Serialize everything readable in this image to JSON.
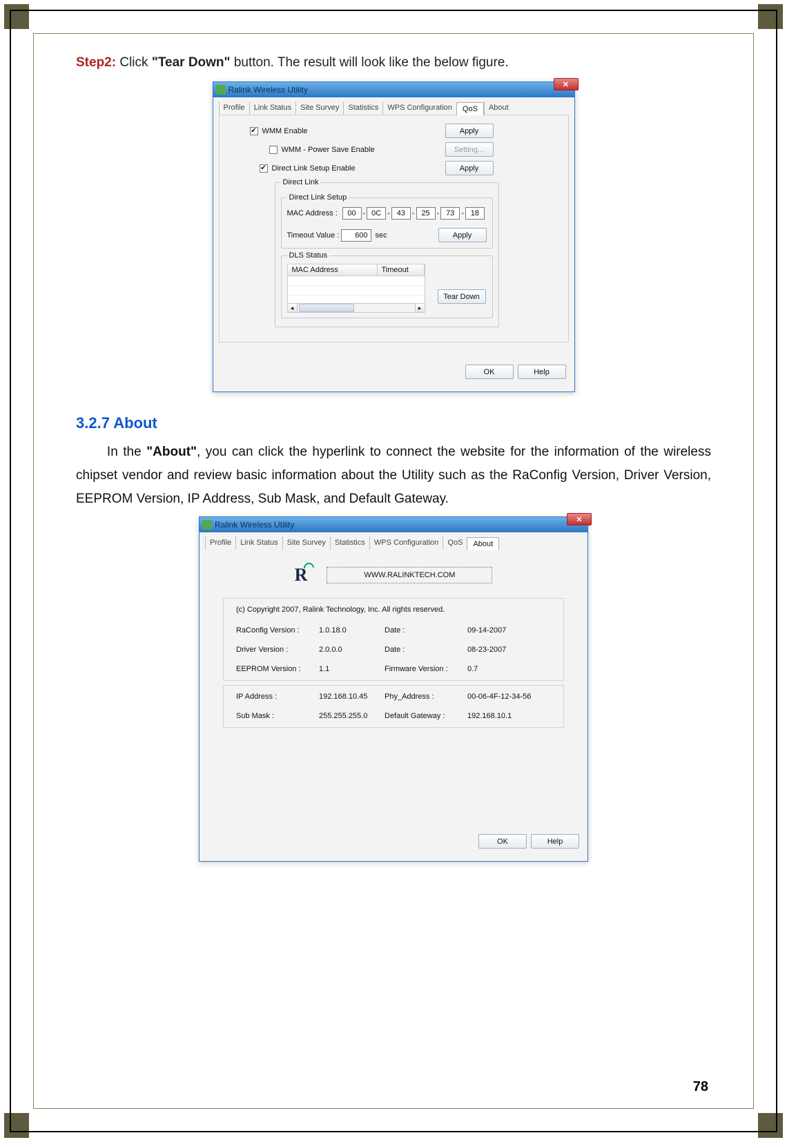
{
  "doc": {
    "step_label": "Step2:",
    "step_text_1": " Click ",
    "step_bold": "\"Tear Down\"",
    "step_text_2": " button. The result will look like the below figure.",
    "section_header": "3.2.7   About",
    "about_para_1": "In the ",
    "about_bold": "\"About\"",
    "about_para_2": ", you can click the hyperlink to connect the website for the information of the wireless chipset vendor and review basic information about the Utility such as the RaConfig Version, Driver Version, EEPROM Version, IP Address, Sub Mask, and Default Gateway.",
    "page_number": "78"
  },
  "dialog1": {
    "title": "Ralink Wireless Utility",
    "close_glyph": "✕",
    "tabs": [
      "Profile",
      "Link Status",
      "Site Survey",
      "Statistics",
      "WPS Configuration",
      "QoS",
      "About"
    ],
    "active_tab_index": 5,
    "wmm_enable": {
      "label": "WMM Enable",
      "checked": true
    },
    "wmm_psave": {
      "label": "WMM - Power Save Enable",
      "checked": false
    },
    "dls_enable": {
      "label": "Direct Link Setup Enable",
      "checked": true
    },
    "btn_apply": "Apply",
    "btn_setting": "Setting...",
    "group_direct_link": "Direct Link",
    "group_dls_setup": "Direct Link Setup",
    "mac_label": "MAC Address :",
    "mac": [
      "00",
      "0C",
      "43",
      "25",
      "73",
      "18"
    ],
    "mac_sep": "-",
    "timeout_label": "Timeout Value :",
    "timeout_value": "600",
    "timeout_unit": "sec",
    "group_dls_status": "DLS Status",
    "dls_cols": [
      "MAC Address",
      "Timeout"
    ],
    "scroll_thumb": "",
    "btn_teardown": "Tear Down",
    "btn_ok": "OK",
    "btn_help": "Help"
  },
  "dialog2": {
    "title": "Ralink Wireless Utility",
    "close_glyph": "✕",
    "tabs": [
      "Profile",
      "Link Status",
      "Site Survey",
      "Statistics",
      "WPS Configuration",
      "QoS",
      "About"
    ],
    "active_tab_index": 6,
    "logo_text": "R",
    "hyperlink": "WWW.RALINKTECH.COM",
    "copyright": "(c) Copyright 2007, Ralink Technology, Inc.  All rights reserved.",
    "rows1": [
      {
        "k1": "RaConfig Version :",
        "v1": "1.0.18.0",
        "k2": "Date :",
        "v2": "09-14-2007"
      },
      {
        "k1": "Driver Version :",
        "v1": "2.0.0.0",
        "k2": "Date :",
        "v2": "08-23-2007"
      },
      {
        "k1": "EEPROM Version :",
        "v1": "1.1",
        "k2": "Firmware Version :",
        "v2": "0.7"
      }
    ],
    "rows2": [
      {
        "k1": "IP Address :",
        "v1": "192.168.10.45",
        "k2": "Phy_Address :",
        "v2": "00-06-4F-12-34-56"
      },
      {
        "k1": "Sub Mask :",
        "v1": "255.255.255.0",
        "k2": "Default Gateway :",
        "v2": "192.168.10.1"
      }
    ],
    "btn_ok": "OK",
    "btn_help": "Help"
  }
}
